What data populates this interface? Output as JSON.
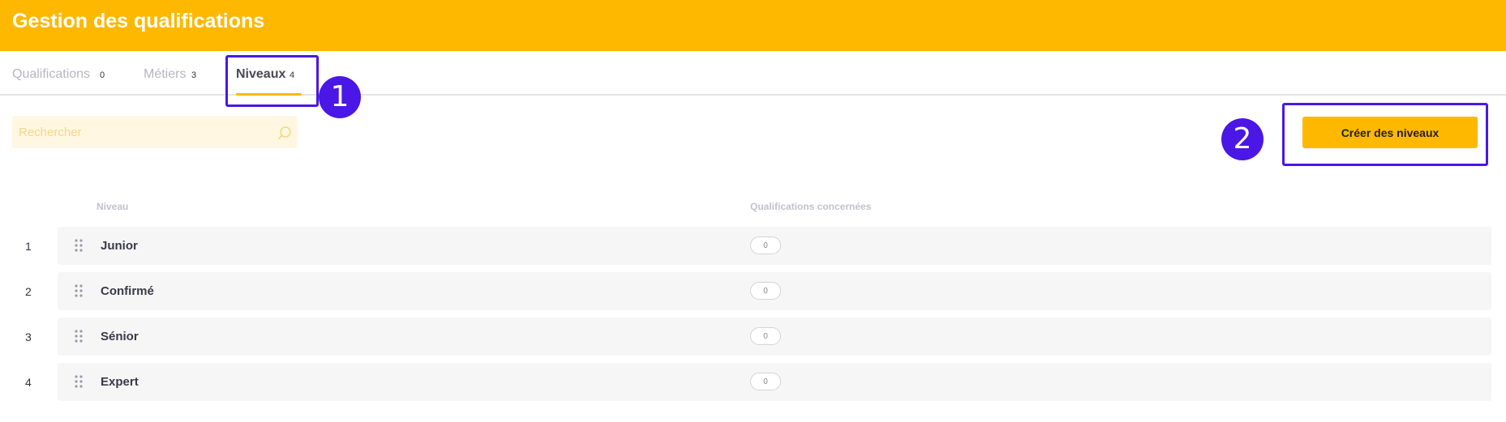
{
  "header": {
    "title": "Gestion des qualifications"
  },
  "tabs": [
    {
      "label": "Qualifications",
      "count": "0"
    },
    {
      "label": "Métiers",
      "count": "3"
    },
    {
      "label": "Niveaux",
      "count": "4"
    }
  ],
  "annotations": [
    "1",
    "2"
  ],
  "search": {
    "placeholder": "Rechercher",
    "icon": "search-icon"
  },
  "actions": {
    "create_label": "Créer des niveaux"
  },
  "table": {
    "columns": [
      "Niveau",
      "Qualifications concernées"
    ],
    "rows": [
      {
        "index": "1",
        "name": "Junior",
        "count": "0"
      },
      {
        "index": "2",
        "name": "Confirmé",
        "count": "0"
      },
      {
        "index": "3",
        "name": "Sénior",
        "count": "0"
      },
      {
        "index": "4",
        "name": "Expert",
        "count": "0"
      }
    ]
  },
  "colors": {
    "accent": "#FFB800",
    "annotation": "#4A17E6",
    "row_bg": "#F6F6F6"
  }
}
